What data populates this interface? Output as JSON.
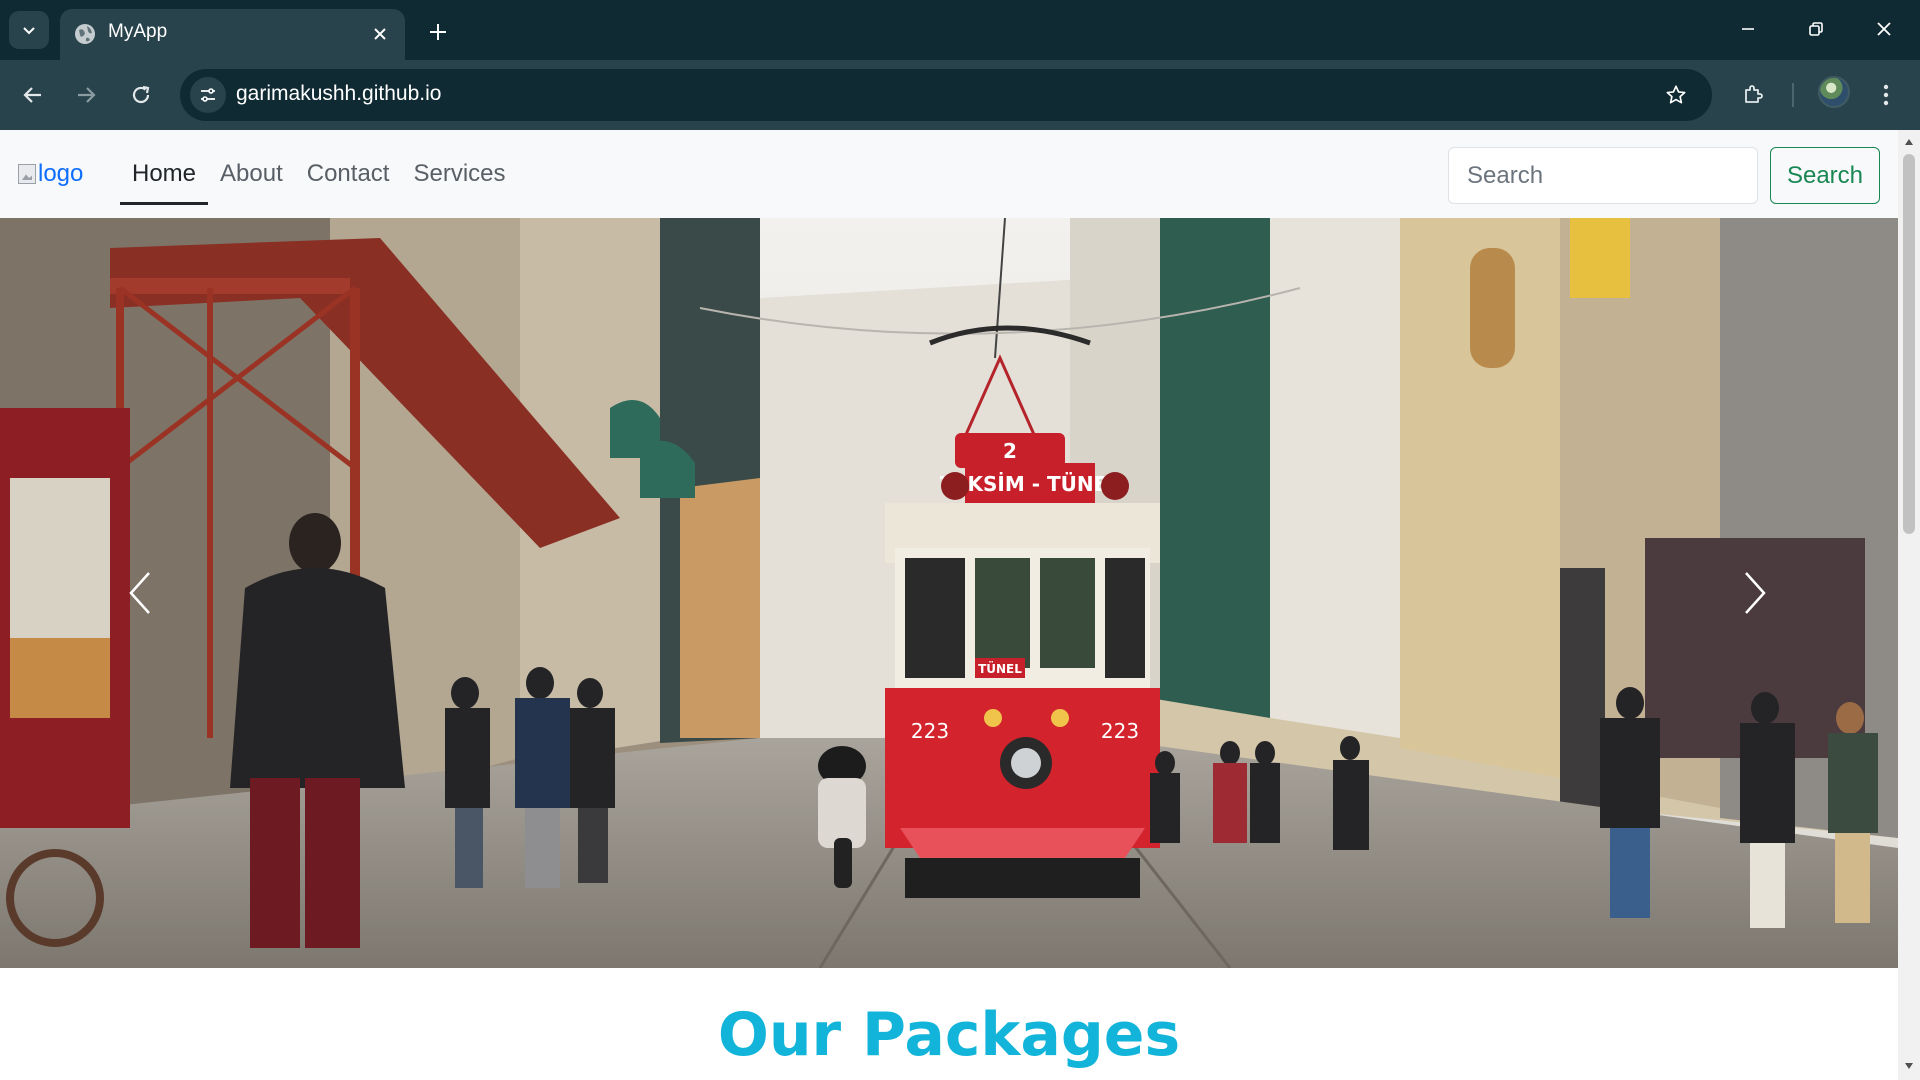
{
  "browser": {
    "tab_title": "MyApp",
    "url": "garimakushh.github.io",
    "colors": {
      "frame": "#0f2a33",
      "toolbar": "#28434c"
    }
  },
  "navbar": {
    "logo_alt": "logo",
    "links": [
      {
        "label": "Home",
        "active": true
      },
      {
        "label": "About",
        "active": false
      },
      {
        "label": "Contact",
        "active": false
      },
      {
        "label": "Services",
        "active": false
      }
    ],
    "search_placeholder": "Search",
    "search_button": "Search"
  },
  "hero": {
    "tram_sign": "TAKSİM - TÜNEL",
    "tram_route": "2",
    "tram_number": "223",
    "tram_label": "TÜNEL"
  },
  "section": {
    "title": "Our Packages",
    "title_color": "#12b5d9"
  }
}
